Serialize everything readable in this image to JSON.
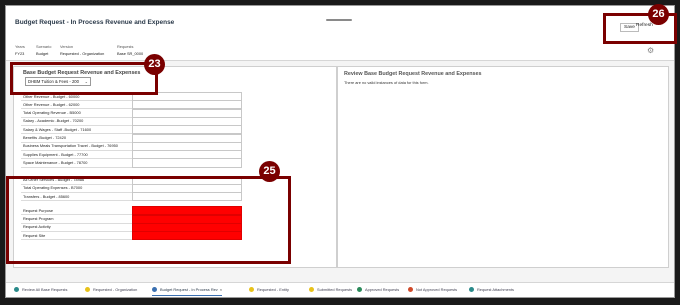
{
  "header": {
    "title": "Budget Request - In Process Revenue and Expense",
    "save_label": "Save",
    "refresh_label": "Refresh"
  },
  "params": [
    {
      "label": "Years",
      "value": "FY23"
    },
    {
      "label": "Scenario",
      "value": "Budget"
    },
    {
      "label": "Version",
      "value": "Requested - Organization"
    },
    {
      "label": "Requests",
      "value": "Base SR_0000"
    }
  ],
  "left_panel": {
    "heading": "Base Budget Request Revenue and Expenses",
    "selector": "DHBM Tuition & Fees - 200"
  },
  "rows": [
    {
      "label": "Other Revenue - Budget - 60000",
      "highlight": false
    },
    {
      "label": "Other Revenue - Budget - 62000",
      "highlight": false
    },
    {
      "label": "Total Operating Revenue - B5000",
      "highlight": false
    },
    {
      "label": "Salary - Academic -Budget - 70200",
      "highlight": false
    },
    {
      "label": "Salary & Wages - Staff -Budget - 71600",
      "highlight": false
    },
    {
      "label": "Benefits -Budget - 72420",
      "highlight": false
    },
    {
      "label": "Business Meals Transportation Travel - Budget - 76950",
      "highlight": false
    },
    {
      "label": "Supplies Equipment - Budget - 77700",
      "highlight": false
    },
    {
      "label": "Space Maintenance - Budget - 78700",
      "highlight": false
    },
    {
      "label": "All Other Services - Budget - 78986",
      "highlight": false
    },
    {
      "label": "Total Operating Expenses - B7000",
      "highlight": false
    },
    {
      "label": "Transfers - Budget - 85600",
      "highlight": false
    },
    {
      "label": "Request Purpose",
      "highlight": true
    },
    {
      "label": "Request Program",
      "highlight": true
    },
    {
      "label": "Request Activity",
      "highlight": true
    },
    {
      "label": "Request Site",
      "highlight": true
    }
  ],
  "right_panel": {
    "heading": "Review Base Budget Request Revenue and Expenses",
    "message": "There are no valid instances of data for this form."
  },
  "tabs": [
    {
      "label": "Review All Base Requests",
      "color": "#2a8a8a"
    },
    {
      "label": "Requested - Organization",
      "color": "#e8c21a"
    },
    {
      "label": "Budget Request - In Process Rev",
      "color": "#3a6fb0",
      "active": true
    },
    {
      "label": "Requested - Entity",
      "color": "#e8c21a"
    },
    {
      "label": "Submitted Requests",
      "color": "#e8c21a"
    },
    {
      "label": "Approved Requests",
      "color": "#2a8a5a"
    },
    {
      "label": "Not Approved Requests",
      "color": "#d04a2a"
    },
    {
      "label": "Request Attachments",
      "color": "#2a8a8a"
    }
  ],
  "annotations": [
    "23",
    "25",
    "26"
  ],
  "colors": {
    "annotation": "#7a0000",
    "required_field": "#ff0000"
  }
}
